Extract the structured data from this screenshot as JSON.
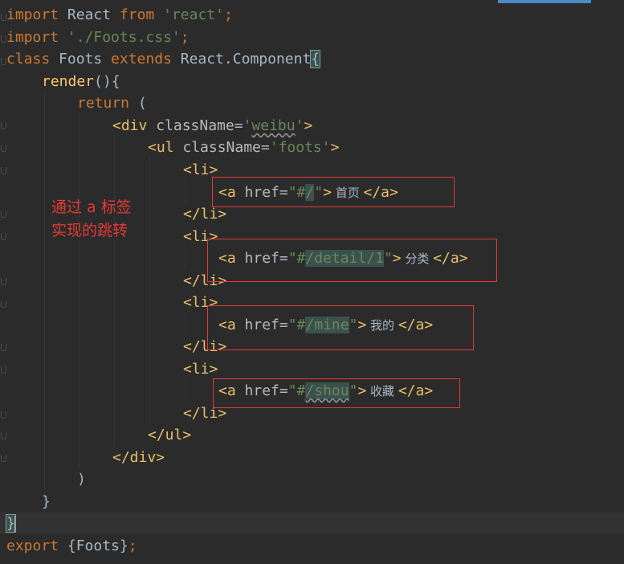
{
  "editor": {
    "accent_color": "#4a88c7",
    "code": {
      "l1": {
        "kw1": "import",
        "name": " React ",
        "kw2": "from",
        "sp": " ",
        "str": "'react'",
        "semi": ";"
      },
      "l2": {
        "kw": "import",
        "sp": " ",
        "str": "'./Foots.css'",
        "semi": ";"
      },
      "l3": {
        "kw1": "class",
        "name": " Foots ",
        "kw2": "extends",
        "base": " React.Component",
        "brace": "{"
      },
      "l4": {
        "fn": "render",
        "rest": "(){"
      },
      "l5": {
        "kw": "return",
        "rest": " ("
      },
      "l6": {
        "open": "<div",
        "attr": " className",
        "eq": "=",
        "q1": "'",
        "val": "weibu",
        "q2": "'",
        "close": ">"
      },
      "l7": {
        "open": "<ul",
        "attr": " className",
        "eq": "=",
        "val": "'foots'",
        "close": ">"
      },
      "l8": {
        "tag": "<li>"
      },
      "l9": {
        "open": "<a",
        "attr": " href",
        "eq": "=",
        "q1": "\"#",
        "val": "/",
        "q2": "\"",
        "close": ">",
        "text": " 首页 ",
        "end": "</a>"
      },
      "l10": {
        "tag": "</li>"
      },
      "l11": {
        "tag": "<li>"
      },
      "l12": {
        "open": "<a",
        "attr": " href",
        "eq": "=",
        "q1": "\"#",
        "val": "/detail/1",
        "q2": "\"",
        "close": ">",
        "text": " 分类 ",
        "end": "</a>"
      },
      "l13": {
        "tag": "</li>"
      },
      "l14": {
        "tag": "<li>"
      },
      "l15": {
        "open": "<a",
        "attr": " href",
        "eq": "=",
        "q1": "\"#",
        "val": "/mine",
        "q2": "\"",
        "close": ">",
        "text": " 我的 ",
        "end": "</a>"
      },
      "l16": {
        "tag": "</li>"
      },
      "l17": {
        "tag": "<li>"
      },
      "l18": {
        "open": "<a",
        "attr": " href",
        "eq": "=",
        "q1": "\"#",
        "val": "/shou",
        "q2": "\"",
        "close": ">",
        "text": " 收藏 ",
        "end": "</a>"
      },
      "l19": {
        "tag": "</li>"
      },
      "l20": {
        "tag": "</ul>"
      },
      "l21": {
        "tag": "</div>"
      },
      "l22": {
        "text": ")"
      },
      "l23": {
        "text": "}"
      },
      "l24": {
        "text": "}"
      },
      "l25": {
        "kw": "export",
        "rest": " {Foots}",
        "semi": ";"
      }
    },
    "annotation": {
      "line1": "通过 a 标签",
      "line2": "实现的跳转"
    },
    "annotation_color": "#e53935"
  }
}
